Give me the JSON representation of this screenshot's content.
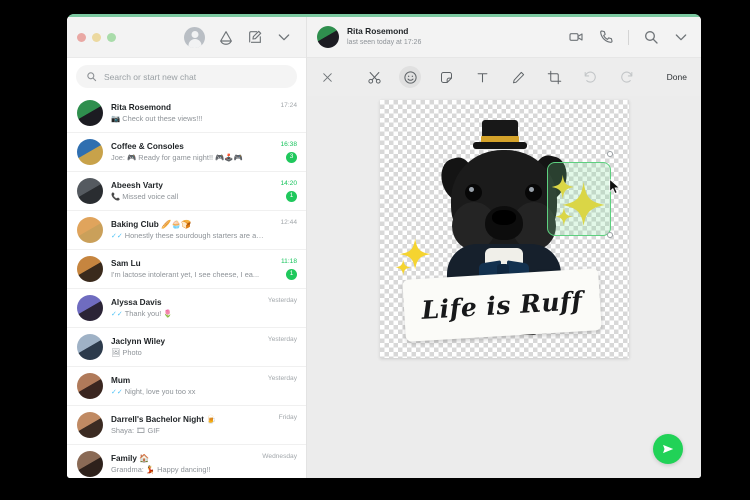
{
  "window": {
    "traffic_lights": [
      "close",
      "minimize",
      "zoom"
    ]
  },
  "sidebar": {
    "header_icons": [
      "profile-avatar",
      "status-icon",
      "new-chat-icon",
      "chevron-down-icon"
    ],
    "search": {
      "placeholder": "Search or start new chat",
      "value": "",
      "icon": "search-icon"
    },
    "chats": [
      {
        "name": "Rita Rosemond",
        "message": "📷 Check out these views!!!",
        "time": "17:24",
        "badge": "",
        "ticks": "",
        "unread": false,
        "avatar_colors": [
          "#2f8f4e",
          "#1c1c22"
        ]
      },
      {
        "name": "Coffee & Consoles",
        "message": "Joe: 🎮 Ready for game night!! 🎮🕹️🎮",
        "time": "16:38",
        "badge": "3",
        "ticks": "",
        "unread": true,
        "avatar_colors": [
          "#2f6fb0",
          "#c8a24a"
        ]
      },
      {
        "name": "Abeesh Varty",
        "message": "📞 Missed voice call",
        "time": "14:20",
        "badge": "1",
        "ticks": "",
        "unread": true,
        "avatar_colors": [
          "#555a60",
          "#2a2d31"
        ]
      },
      {
        "name": "Baking Club 🥖🧁🍞",
        "message": "Honestly these sourdough starters are awful...",
        "time": "12:44",
        "badge": "",
        "ticks": "✓✓",
        "unread": false,
        "avatar_colors": [
          "#e0a45c",
          "#caa05a"
        ]
      },
      {
        "name": "Sam Lu",
        "message": "I'm lactose intolerant yet, I see cheese, I ea...",
        "time": "11:18",
        "badge": "1",
        "ticks": "",
        "unread": true,
        "avatar_colors": [
          "#c6853f",
          "#3a2a1c"
        ]
      },
      {
        "name": "Alyssa Davis",
        "message": "Thank you! 🌷",
        "time": "Yesterday",
        "badge": "",
        "ticks": "✓✓",
        "unread": false,
        "avatar_colors": [
          "#6f6cc0",
          "#2b2436"
        ]
      },
      {
        "name": "Jaclynn Wiley",
        "message": "🖼 Photo",
        "time": "Yesterday",
        "badge": "",
        "ticks": "",
        "unread": false,
        "avatar_colors": [
          "#9fb2c6",
          "#2d3b4c"
        ]
      },
      {
        "name": "Mum",
        "message": "Night, love you too xx",
        "time": "Yesterday",
        "badge": "",
        "ticks": "✓✓",
        "unread": false,
        "avatar_colors": [
          "#b07a5a",
          "#3a2620"
        ]
      },
      {
        "name": "Darrell's Bachelor Night 🍺",
        "message": "Shaya: 🎞 GIF",
        "time": "Friday",
        "badge": "",
        "ticks": "",
        "unread": false,
        "avatar_colors": [
          "#c08a63",
          "#3b2b22"
        ]
      },
      {
        "name": "Family 🏠",
        "message": "Grandma: 💃 Happy dancing!!",
        "time": "Wednesday",
        "badge": "",
        "ticks": "",
        "unread": false,
        "avatar_colors": [
          "#8a6a55",
          "#2e211b"
        ]
      }
    ]
  },
  "conversation": {
    "title": "Rita Rosemond",
    "subtitle": "last seen today at 17:26",
    "header_icons": [
      "video-call-icon",
      "voice-call-icon",
      "search-icon",
      "chevron-down-icon"
    ]
  },
  "editor": {
    "close_icon": "close-icon",
    "done_label": "Done",
    "tools": [
      {
        "name": "crop-cut-icon",
        "label": "Cut",
        "active": false,
        "disabled": false
      },
      {
        "name": "emoji-icon",
        "label": "Emoji",
        "active": true,
        "disabled": false
      },
      {
        "name": "sticker-icon",
        "label": "Sticker",
        "active": false,
        "disabled": false
      },
      {
        "name": "text-icon",
        "label": "Text",
        "active": false,
        "disabled": false
      },
      {
        "name": "pencil-icon",
        "label": "Draw",
        "active": false,
        "disabled": false
      },
      {
        "name": "crop-icon",
        "label": "Crop",
        "active": false,
        "disabled": false
      },
      {
        "name": "undo-icon",
        "label": "Undo",
        "active": false,
        "disabled": true
      },
      {
        "name": "redo-icon",
        "label": "Redo",
        "active": false,
        "disabled": true
      }
    ],
    "canvas": {
      "background": "transparent-checkerboard",
      "sign_text": "Life is Ruff",
      "stickers": [
        {
          "name": "sparkles-sticker",
          "selected": false
        },
        {
          "name": "sparkles-sticker",
          "selected": true
        }
      ],
      "selection_color": "#5dd07f"
    },
    "send_button": {
      "name": "send-icon",
      "color": "#21d257"
    }
  }
}
